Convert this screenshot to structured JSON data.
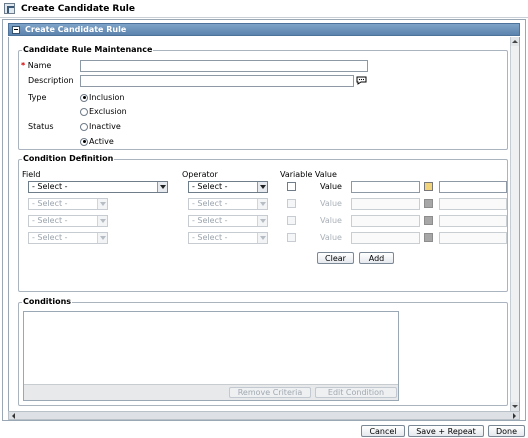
{
  "window": {
    "title": "Create Candidate Rule"
  },
  "panel": {
    "title": "Create Candidate Rule"
  },
  "maintenance": {
    "legend": "Candidate Rule Maintenance",
    "name_label": "Name",
    "name_value": "",
    "description_label": "Description",
    "description_value": "",
    "type_label": "Type",
    "type_options": [
      "Inclusion",
      "Exclusion"
    ],
    "type_selected": "Inclusion",
    "status_label": "Status",
    "status_options": [
      "Inactive",
      "Active"
    ],
    "status_selected": "Active"
  },
  "condition_definition": {
    "legend": "Condition Definition",
    "field_header": "Field",
    "operator_header": "Operator",
    "variable_value_header": "Variable Value",
    "rows": [
      {
        "field": "- Select -",
        "operator": "- Select -",
        "value_label": "Value",
        "enabled": true
      },
      {
        "field": "- Select -",
        "operator": "- Select -",
        "value_label": "Value",
        "enabled": false
      },
      {
        "field": "- Select -",
        "operator": "- Select -",
        "value_label": "Value",
        "enabled": false
      },
      {
        "field": "- Select -",
        "operator": "- Select -",
        "value_label": "Value",
        "enabled": false
      }
    ],
    "clear_label": "Clear",
    "add_label": "Add"
  },
  "conditions": {
    "legend": "Conditions",
    "remove_criteria_label": "Remove  Criteria",
    "edit_condition_label": "Edit Condition"
  },
  "footer": {
    "cancel_label": "Cancel",
    "save_repeat_label": "Save + Repeat",
    "done_label": "Done"
  },
  "icons": {
    "app": "window-icon",
    "comment": "comment-bubble-icon",
    "calculator": "calculator-icon"
  },
  "colors": {
    "header_blue": "#5b83ad",
    "required": "#d00000"
  }
}
